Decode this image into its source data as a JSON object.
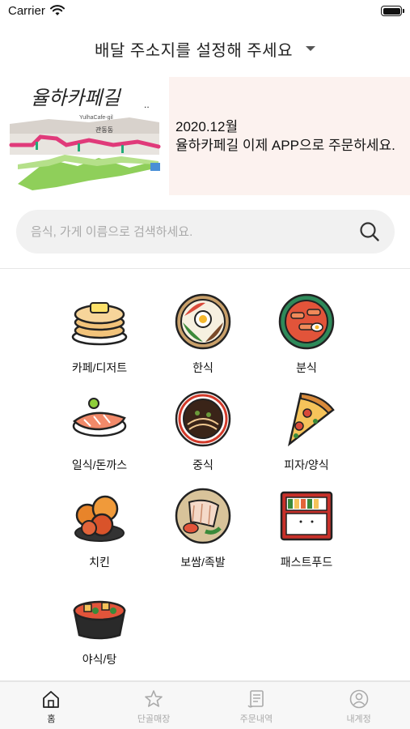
{
  "status_bar": {
    "carrier": "Carrier"
  },
  "header": {
    "address_prompt": "배달 주소지를 설정해 주세요"
  },
  "banner": {
    "logo_text": "율하카페길",
    "logo_subtext": "YulhaCafe-gil",
    "map_label": "관동동",
    "line1": "2020.12월",
    "line2": "율하카페길 이제 APP으로 주문하세요.",
    "background_color": "#fcf2ef"
  },
  "search": {
    "placeholder": "음식, 가게 이름으로 검색하세요.",
    "value": ""
  },
  "categories": [
    {
      "label": "카페/디저트",
      "icon": "pancake-icon"
    },
    {
      "label": "한식",
      "icon": "bibimbap-icon"
    },
    {
      "label": "분식",
      "icon": "tteokbokki-icon"
    },
    {
      "label": "일식/돈까스",
      "icon": "sushi-icon"
    },
    {
      "label": "중식",
      "icon": "jajangmyeon-icon"
    },
    {
      "label": "피자/양식",
      "icon": "pizza-icon"
    },
    {
      "label": "치킨",
      "icon": "chicken-icon"
    },
    {
      "label": "보쌈/족발",
      "icon": "bossam-icon"
    },
    {
      "label": "패스트푸드",
      "icon": "lunchbox-icon"
    },
    {
      "label": "야식/탕",
      "icon": "stew-icon"
    }
  ],
  "tab_bar": {
    "items": [
      {
        "label": "홈",
        "icon": "home-icon",
        "active": true
      },
      {
        "label": "단골매장",
        "icon": "star-icon",
        "active": false
      },
      {
        "label": "주문내역",
        "icon": "receipt-icon",
        "active": false
      },
      {
        "label": "내계정",
        "icon": "user-icon",
        "active": false
      }
    ],
    "active_color": "#222222",
    "inactive_color": "#aaaaaa"
  }
}
